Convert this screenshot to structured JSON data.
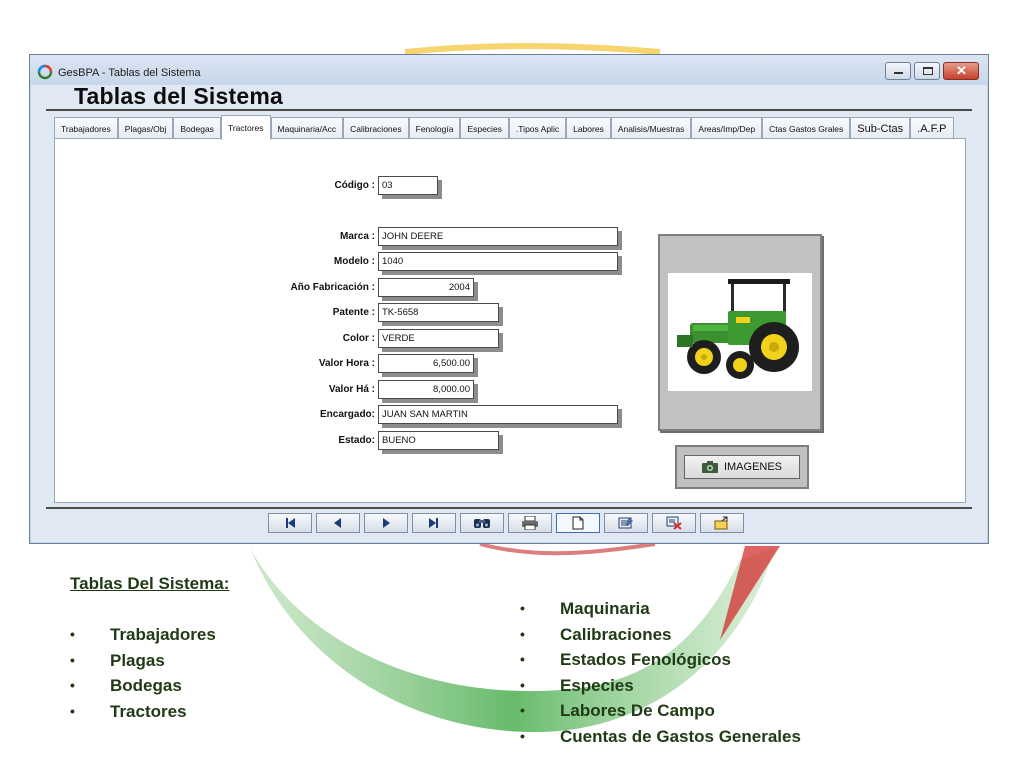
{
  "window": {
    "title": "GesBPA - Tablas del Sistema",
    "heading": "Tablas del Sistema",
    "colors": {
      "titlebar": "#dbe6f4",
      "close": "#c5412b",
      "panel": "#ffffff"
    }
  },
  "tabs": [
    {
      "label": "Trabajadores",
      "active": false
    },
    {
      "label": "Plagas/Obj",
      "active": false
    },
    {
      "label": "Bodegas",
      "active": false
    },
    {
      "label": "Tractores",
      "active": true
    },
    {
      "label": "Maquinaria/Acc",
      "active": false
    },
    {
      "label": "Calibraciones",
      "active": false
    },
    {
      "label": "Fenología",
      "active": false
    },
    {
      "label": "Especies",
      "active": false
    },
    {
      "label": ".Tipos Aplic",
      "active": false
    },
    {
      "label": "Labores",
      "active": false
    },
    {
      "label": "Analisis/Muestras",
      "active": false
    },
    {
      "label": "Areas/Imp/Dep",
      "active": false
    },
    {
      "label": "Ctas Gastos Grales",
      "active": false
    },
    {
      "label": "Sub-Ctas",
      "active": false
    },
    {
      "label": ".A.F.P",
      "active": false
    }
  ],
  "form": {
    "codigo": {
      "label": "Código :",
      "value": "03"
    },
    "marca": {
      "label": "Marca :",
      "value": "JOHN DEERE"
    },
    "modelo": {
      "label": "Modelo :",
      "value": "1040"
    },
    "anio": {
      "label": "Año Fabricación :",
      "value": "2004"
    },
    "patente": {
      "label": "Patente :",
      "value": "TK-5658"
    },
    "color": {
      "label": "Color :",
      "value": "VERDE"
    },
    "valor_hora": {
      "label": "Valor Hora :",
      "value": "6,500.00"
    },
    "valor_ha": {
      "label": "Valor Há :",
      "value": "8,000.00"
    },
    "encargado": {
      "label": "Encargado:",
      "value": "JUAN SAN MARTIN"
    },
    "estado": {
      "label": "Estado:",
      "value": "BUENO"
    }
  },
  "images_button": {
    "label": "IMAGENES",
    "icon": "camera-icon"
  },
  "navigation": [
    {
      "icon": "first-record-icon"
    },
    {
      "icon": "previous-record-icon"
    },
    {
      "icon": "next-record-icon"
    },
    {
      "icon": "last-record-icon"
    },
    {
      "icon": "search-binoculars-icon"
    },
    {
      "icon": "print-icon"
    },
    {
      "icon": "new-record-icon",
      "active": true
    },
    {
      "icon": "edit-record-icon"
    },
    {
      "icon": "delete-record-icon"
    },
    {
      "icon": "exit-icon"
    }
  ],
  "slide": {
    "heading": "Tablas Del Sistema:",
    "left_bullets": [
      "Trabajadores",
      "Plagas",
      "Bodegas",
      "Tractores"
    ],
    "right_bullets": [
      "Maquinaria",
      "Calibraciones",
      "Estados Fenológicos",
      "Especies",
      "Labores De Campo",
      "Cuentas de Gastos Generales"
    ],
    "colors": {
      "text": "#1f3a14",
      "arc_green": "#4caf50",
      "arc_red": "#c62828",
      "arc_yellow": "#f2c230"
    }
  }
}
